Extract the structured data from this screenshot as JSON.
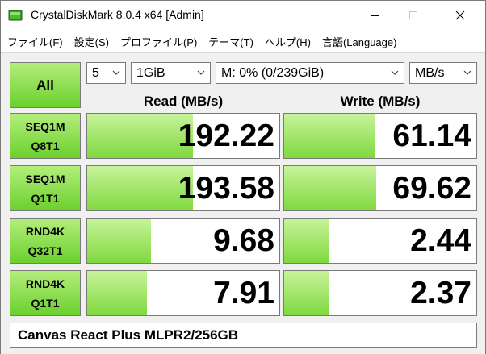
{
  "window": {
    "title": "CrystalDiskMark 8.0.4 x64 [Admin]",
    "app_icon": "crystaldiskmark-icon",
    "controls": {
      "minimize": "minimize-icon",
      "maximize": "maximize-icon",
      "close": "close-icon"
    }
  },
  "menu": [
    "ファイル(F)",
    "設定(S)",
    "プロファイル(P)",
    "テーマ(T)",
    "ヘルプ(H)",
    "言語(Language)"
  ],
  "controls": {
    "all_label": "All",
    "count": "5",
    "size": "1GiB",
    "drive": "M: 0% (0/239GiB)",
    "unit": "MB/s"
  },
  "headers": {
    "read": "Read (MB/s)",
    "write": "Write (MB/s)"
  },
  "tests": [
    {
      "line1": "SEQ1M",
      "line2": "Q8T1",
      "read": "192.22",
      "write": "61.14",
      "read_fill": 0.55,
      "write_fill": 0.47
    },
    {
      "line1": "SEQ1M",
      "line2": "Q1T1",
      "read": "193.58",
      "write": "69.62",
      "read_fill": 0.55,
      "write_fill": 0.48
    },
    {
      "line1": "RND4K",
      "line2": "Q32T1",
      "read": "9.68",
      "write": "2.44",
      "read_fill": 0.33,
      "write_fill": 0.23
    },
    {
      "line1": "RND4K",
      "line2": "Q1T1",
      "read": "7.91",
      "write": "2.37",
      "read_fill": 0.31,
      "write_fill": 0.23
    }
  ],
  "comment": "Canvas React Plus MLPR2/256GB",
  "colors": {
    "accent_green": "#6bd02e",
    "meter_green": "#7fd93f",
    "background": "#f0f0f0"
  }
}
